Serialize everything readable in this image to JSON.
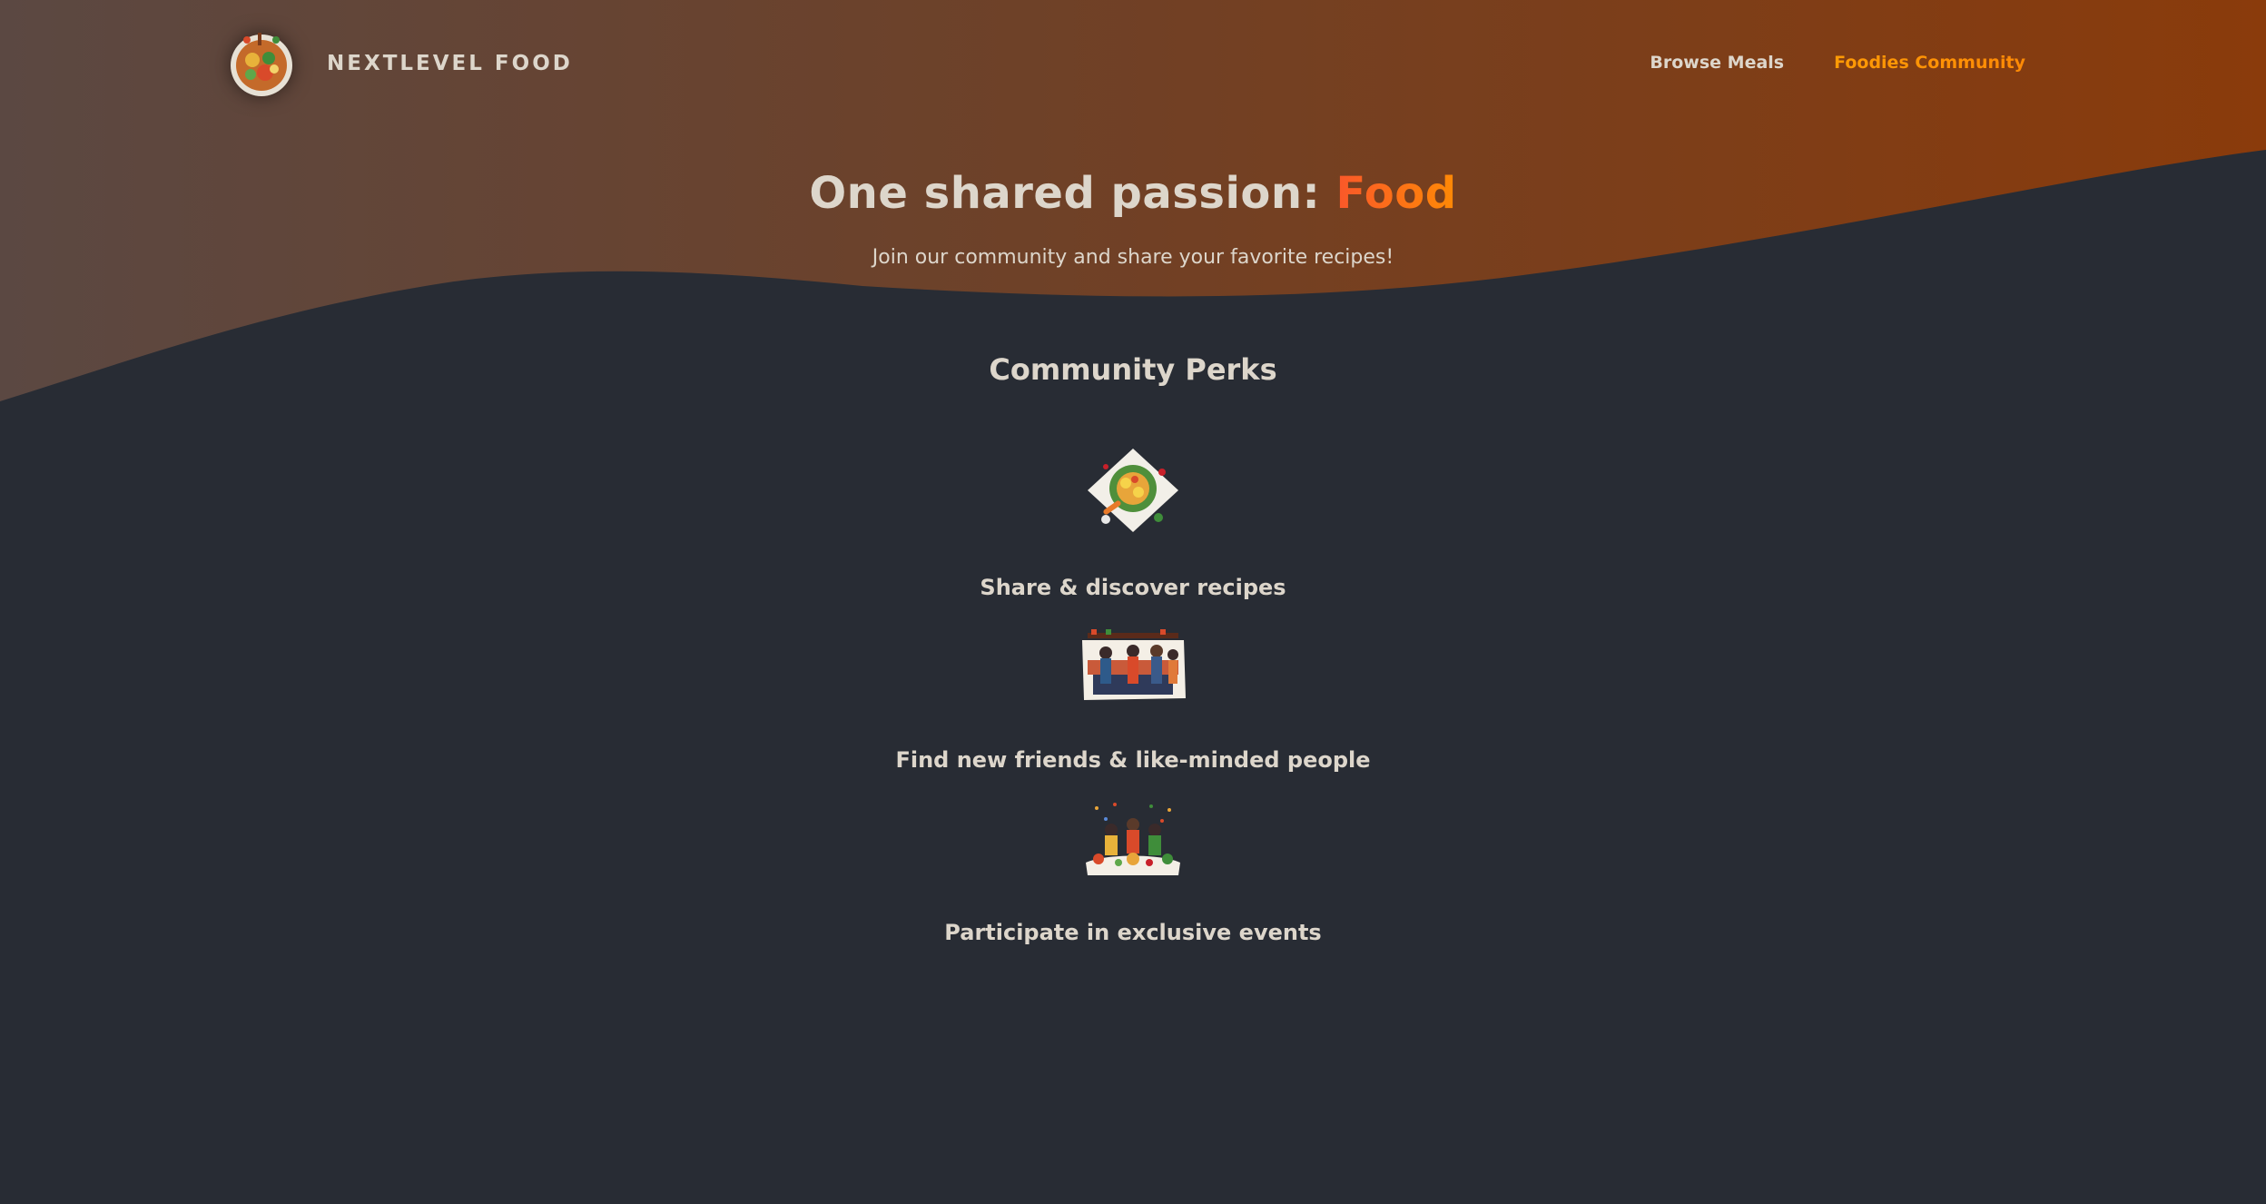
{
  "header": {
    "logo_alt": "A plate with food on it",
    "brand": "NextLevel Food",
    "nav": [
      {
        "label": "Browse Meals",
        "active": false
      },
      {
        "label": "Foodies Community",
        "active": true
      }
    ]
  },
  "hero": {
    "title_prefix": "One shared passion: ",
    "title_highlight": "Food",
    "subtitle": "Join our community and share your favorite recipes!"
  },
  "perks": {
    "heading": "Community Perks",
    "items": [
      {
        "label": "Share & discover recipes",
        "icon": "recipes-plate-illustration"
      },
      {
        "label": "Find new friends & like-minded people",
        "icon": "community-kitchen-illustration"
      },
      {
        "label": "Participate in exclusive events",
        "icon": "events-party-illustration"
      }
    ]
  },
  "colors": {
    "background": "#282c34",
    "header_gradient_start": "#5a4a45",
    "header_gradient_end": "#8a3e0f",
    "accent_orange": "#ff8a05",
    "accent_red": "#f9572a",
    "text": "#ddd6cb",
    "active_nav": "#f9a825"
  }
}
